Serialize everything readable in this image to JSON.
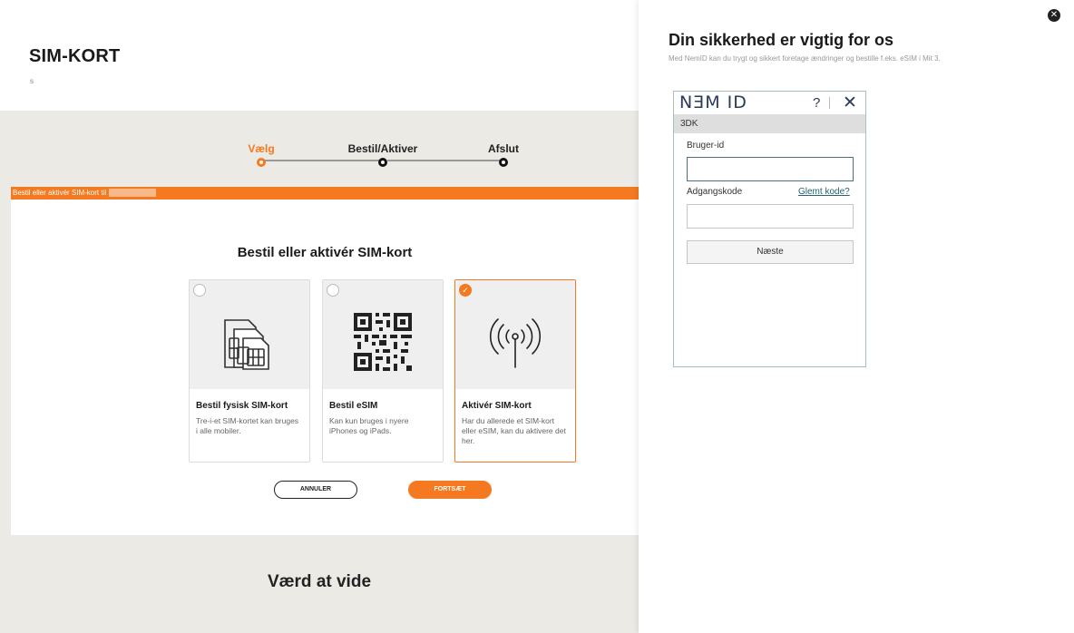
{
  "page": {
    "title": "SIM-KORT",
    "subtitle": "s"
  },
  "stepper": {
    "steps": [
      {
        "label": "Vælg",
        "active": true
      },
      {
        "label": "Bestil/Aktiver",
        "active": false
      },
      {
        "label": "Afslut",
        "active": false
      }
    ]
  },
  "banner": {
    "text": "Bestil eller aktivér SIM-kort til"
  },
  "panel": {
    "title": "Bestil eller aktivér SIM-kort",
    "options": [
      {
        "title": "Bestil fysisk SIM-kort",
        "description": "Tre-i-et SIM-kortet kan bruges i alle mobiler.",
        "icon": "sim-cards-icon",
        "selected": false
      },
      {
        "title": "Bestil eSIM",
        "description": "Kan kun bruges i nyere iPhones og iPads.",
        "icon": "qr-code-icon",
        "selected": false
      },
      {
        "title": "Aktivér SIM-kort",
        "description": "Har du allerede et SIM-kort eller eSIM, kan du aktivere det her.",
        "icon": "antenna-icon",
        "selected": true
      }
    ],
    "cancel_label": "ANNULER",
    "continue_label": "FORTSÆT"
  },
  "section": {
    "title": "Værd at vide"
  },
  "side_panel": {
    "close_symbol": "✕",
    "title": "Din sikkerhed er vigtig for os",
    "subtitle": "Med NemID kan du trygt og sikkert foretage ændringer og bestille f.eks. eSIM i Mit 3.",
    "nemid": {
      "logo": "NƎM ID",
      "help": "?",
      "close": "✕",
      "band": "3DK",
      "user_label": "Bruger-id",
      "user_value": "",
      "password_label": "Adgangskode",
      "forgot_link": "Glemt kode?",
      "password_value": "",
      "next_label": "Næste"
    }
  },
  "colors": {
    "accent": "#f47920",
    "background_gray": "#ebeae5",
    "nemid_border": "#a9c2b9"
  }
}
